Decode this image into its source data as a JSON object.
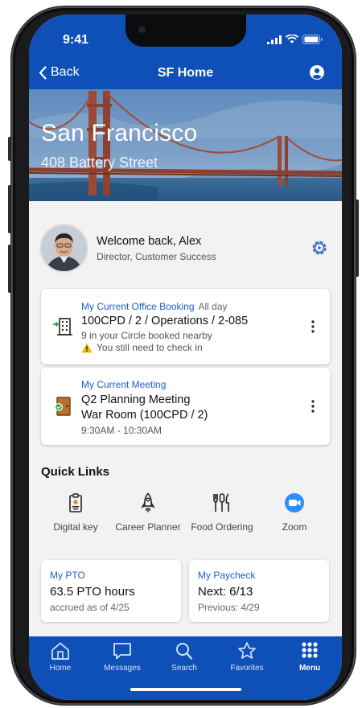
{
  "status_bar": {
    "time": "9:41"
  },
  "nav": {
    "back_label": "Back",
    "title": "SF Home",
    "profile_icon": "profile-icon"
  },
  "hero": {
    "city": "San Francisco",
    "address": "408 Battery Street"
  },
  "welcome": {
    "greeting": "Welcome back, Alex",
    "role": "Director, Customer Success",
    "settings_icon": "settings-icon"
  },
  "office_booking": {
    "overline": "My Current Office Booking",
    "tag": "All day",
    "location": "100CPD / 2 / Operations / 2-085",
    "circle_note": "9 in your Circle booked nearby",
    "warning": "You still need to check in",
    "icon": "building-checkin-icon"
  },
  "meeting": {
    "overline": "My Current Meeting",
    "title": "Q2 Planning Meeting",
    "room": "War Room (100CPD / 2)",
    "time": "9:30AM - 10:30AM",
    "icon": "door-icon"
  },
  "quick_links": {
    "title": "Quick Links",
    "items": [
      {
        "label": "Digital key",
        "icon": "badge-icon"
      },
      {
        "label": "Career Planner",
        "icon": "rocket-icon"
      },
      {
        "label": "Food Ordering",
        "icon": "utensils-icon"
      },
      {
        "label": "Zoom",
        "icon": "zoom-icon"
      }
    ]
  },
  "tiles": [
    {
      "title": "My PTO",
      "value": "63.5 PTO hours",
      "sub": "accrued as of 4/25"
    },
    {
      "title": "My Paycheck",
      "value": "Next: 6/13",
      "sub": "Previous: 4/29"
    }
  ],
  "tabbar": {
    "active": "Menu",
    "items": [
      {
        "label": "Home",
        "icon": "home-icon"
      },
      {
        "label": "Messages",
        "icon": "chat-icon"
      },
      {
        "label": "Search",
        "icon": "search-icon"
      },
      {
        "label": "Favorites",
        "icon": "star-icon"
      },
      {
        "label": "Menu",
        "icon": "grid-menu-icon"
      }
    ]
  },
  "colors": {
    "primary": "#0f4fb8",
    "link": "#1d5fc9",
    "warning": "#f2b705",
    "zoom": "#2d8cff",
    "background": "#f2f2f2"
  }
}
